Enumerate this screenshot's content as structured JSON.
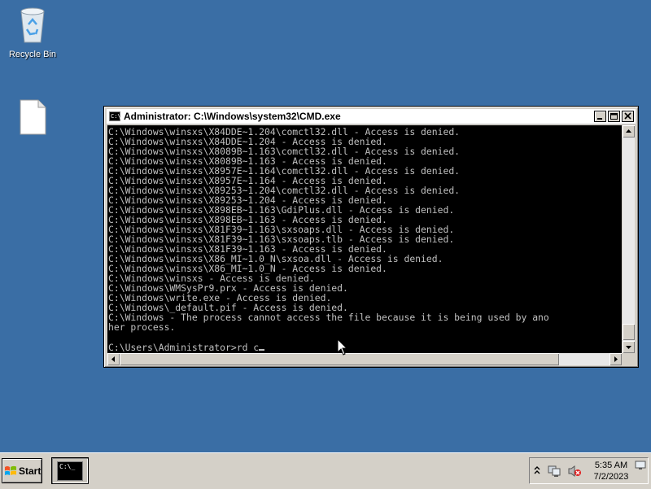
{
  "desktop": {
    "recycle_bin_label": "Recycle Bin"
  },
  "cmd_window": {
    "title": "Administrator: C:\\Windows\\system32\\CMD.exe",
    "icon_text": "C:\\.",
    "output": "C:\\Windows\\winsxs\\X84DDE~1.204\\comctl32.dll - Access is denied.\nC:\\Windows\\winsxs\\X84DDE~1.204 - Access is denied.\nC:\\Windows\\winsxs\\X8089B~1.163\\comctl32.dll - Access is denied.\nC:\\Windows\\winsxs\\X8089B~1.163 - Access is denied.\nC:\\Windows\\winsxs\\X8957E~1.164\\comctl32.dll - Access is denied.\nC:\\Windows\\winsxs\\X8957E~1.164 - Access is denied.\nC:\\Windows\\winsxs\\X89253~1.204\\comctl32.dll - Access is denied.\nC:\\Windows\\winsxs\\X89253~1.204 - Access is denied.\nC:\\Windows\\winsxs\\X898EB~1.163\\GdiPlus.dll - Access is denied.\nC:\\Windows\\winsxs\\X898EB~1.163 - Access is denied.\nC:\\Windows\\winsxs\\X81F39~1.163\\sxsoaps.dll - Access is denied.\nC:\\Windows\\winsxs\\X81F39~1.163\\sxsoaps.tlb - Access is denied.\nC:\\Windows\\winsxs\\X81F39~1.163 - Access is denied.\nC:\\Windows\\winsxs\\X86_MI~1.0_N\\sxsoa.dll - Access is denied.\nC:\\Windows\\winsxs\\X86_MI~1.0_N - Access is denied.\nC:\\Windows\\winsxs - Access is denied.\nC:\\Windows\\WMSysPr9.prx - Access is denied.\nC:\\Windows\\write.exe - Access is denied.\nC:\\Windows\\_default.pif - Access is denied.\nC:\\Windows - The process cannot access the file because it is being used by ano\nher process.\n\n",
    "prompt_line": "C:\\Users\\Administrator>rd c"
  },
  "taskbar": {
    "start_label": "Start",
    "cmd_task_icon_text": "C:\\_",
    "clock_time": "5:35 AM",
    "clock_date": "7/2/2023"
  },
  "colors": {
    "desktop": "#3a6ea5",
    "console_bg": "#000000",
    "console_text": "#c0c0c0"
  }
}
